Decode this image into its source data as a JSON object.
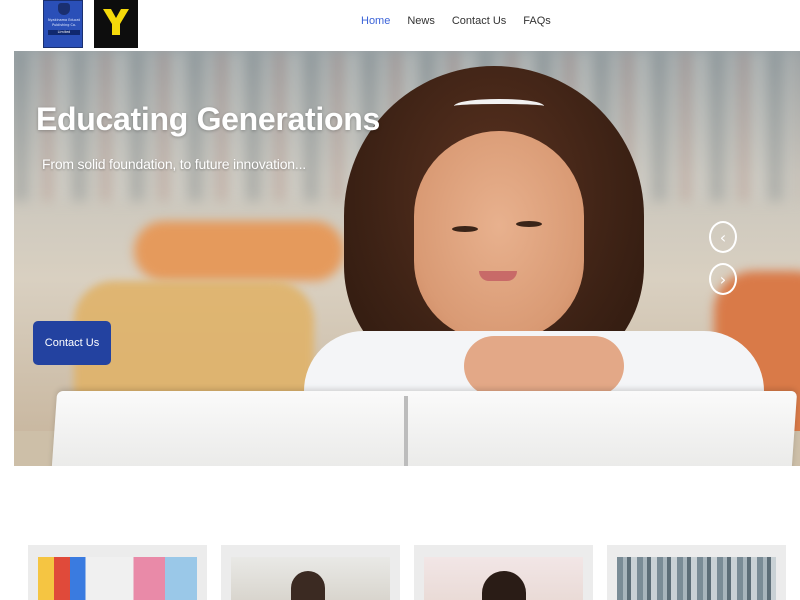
{
  "header": {
    "logo_school_lines": [
      "Nyakinama Educational",
      "Publishing Co.",
      "Limited"
    ],
    "logo_y_letter": "Y",
    "nav": [
      {
        "label": "Home",
        "active": true
      },
      {
        "label": "News",
        "active": false
      },
      {
        "label": "Contact Us",
        "active": false
      },
      {
        "label": "FAQs",
        "active": false
      }
    ]
  },
  "hero": {
    "title": "Educating Generations",
    "subtitle": "From solid foundation, to future innovation...",
    "cta_label": "Contact Us",
    "prev_icon": "chevron-left-icon",
    "next_icon": "chevron-right-icon",
    "prev_glyph": "‹",
    "next_glyph": "›"
  },
  "cards": [
    {
      "image": "school-supplies-image"
    },
    {
      "image": "student-image"
    },
    {
      "image": "child-image"
    },
    {
      "image": "library-image"
    }
  ],
  "colors": {
    "nav_active": "#3b63d8",
    "cta_background": "#2342a0",
    "logo_y_fg": "#f5d90a",
    "logo_y_bg": "#0d0d0d"
  }
}
